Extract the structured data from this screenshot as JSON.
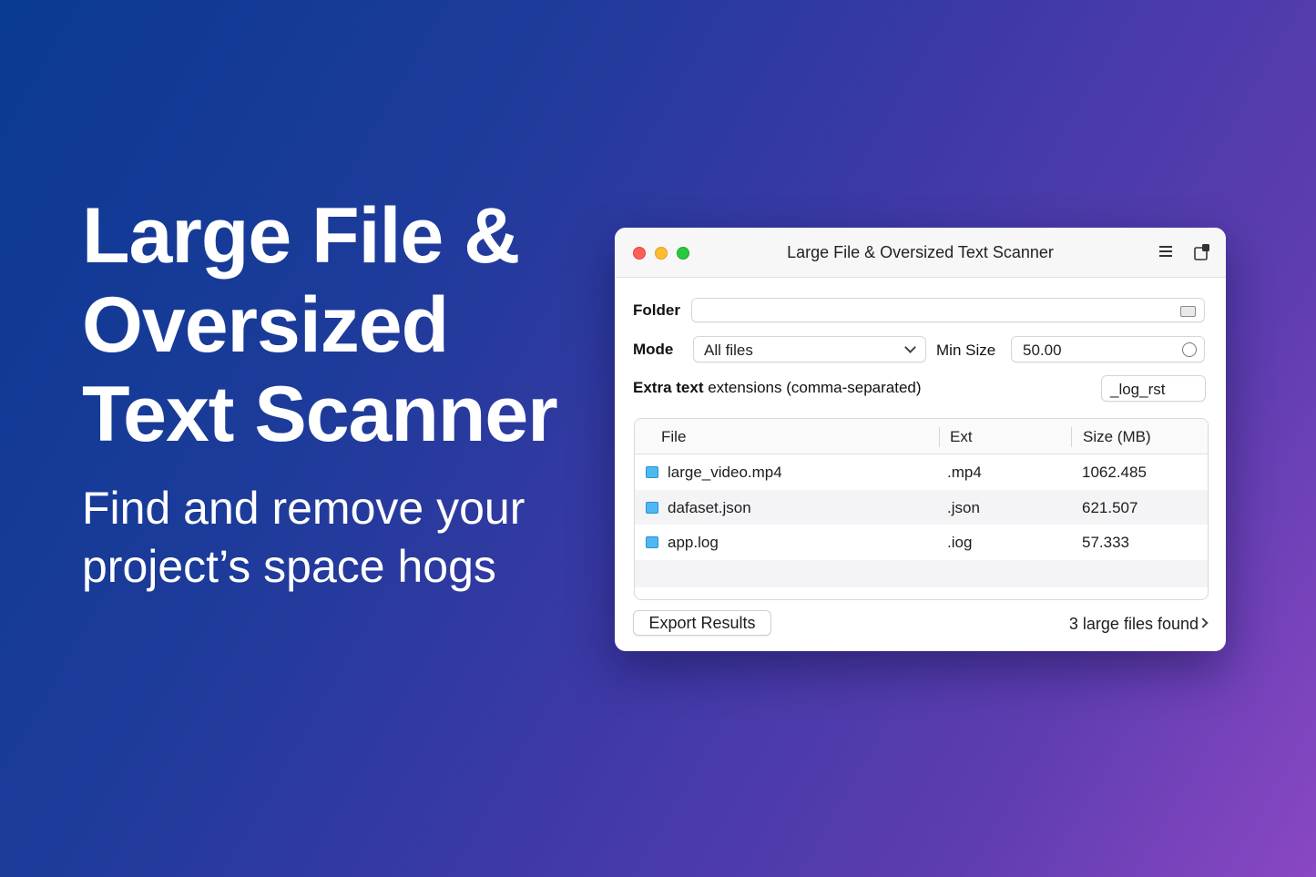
{
  "hero": {
    "title": "Large File &\nOversized\nText Scanner",
    "subtitle": "Find and remove your\nproject’s space hogs"
  },
  "window": {
    "title": "Large File & Oversized Text Scanner",
    "folder_label": "Folder",
    "folder_value": "",
    "mode_label": "Mode",
    "mode_value": "All files",
    "min_size_label": "Min  Size",
    "min_size_value": "50.00",
    "ext_label_bold": "Extra text",
    "ext_label_rest": " extensions (comma-separated)",
    "ext_value": "_log_rst",
    "table": {
      "columns": [
        "File",
        "Ext",
        "Size (MB)"
      ],
      "rows": [
        {
          "file": "large_video.mp4",
          "ext": ".mp4",
          "size": "1062.485"
        },
        {
          "file": "dafaset.json",
          "ext": ".json",
          "size": "621.507"
        },
        {
          "file": "app.log",
          "ext": ".iog",
          "size": "57.333"
        }
      ]
    },
    "export_label": "Export Results",
    "status_text": "3 large files found"
  },
  "colors": {
    "bg_start": "#0a3a92",
    "bg_end": "#8a47c4",
    "file_icon": "#4fb8f3"
  },
  "icons": [
    "close-dot",
    "minimize-dot",
    "zoom-dot",
    "menu-icon",
    "popout-icon",
    "drive-icon",
    "chevron-down-icon",
    "stepper-icon",
    "file-icon",
    "chevron-right-icon"
  ]
}
